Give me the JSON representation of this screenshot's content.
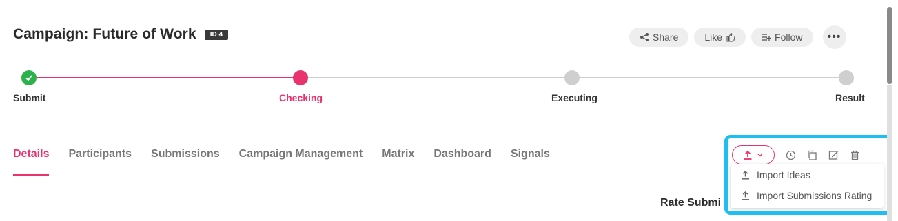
{
  "header": {
    "title": "Campaign: Future of Work",
    "id_badge": "ID 4",
    "share_label": "Share",
    "like_label": "Like",
    "follow_label": "Follow",
    "more_label": "•••"
  },
  "progress": {
    "steps": [
      {
        "label": "Submit",
        "state": "done"
      },
      {
        "label": "Checking",
        "state": "active"
      },
      {
        "label": "Executing",
        "state": "todo"
      },
      {
        "label": "Result",
        "state": "todo"
      }
    ]
  },
  "tabs": [
    {
      "label": "Details",
      "active": true
    },
    {
      "label": "Participants",
      "active": false
    },
    {
      "label": "Submissions",
      "active": false
    },
    {
      "label": "Campaign Management",
      "active": false
    },
    {
      "label": "Matrix",
      "active": false
    },
    {
      "label": "Dashboard",
      "active": false
    },
    {
      "label": "Signals",
      "active": false
    }
  ],
  "toolbar": {
    "icons": [
      "upload-icon",
      "chevron-down-icon",
      "history-icon",
      "copy-icon",
      "edit-icon",
      "trash-icon"
    ]
  },
  "import_menu": {
    "items": [
      "Import Ideas",
      "Import Submissions Rating"
    ]
  },
  "content": {
    "rate_label": "Rate Submi"
  },
  "colors": {
    "accent": "#e8336e",
    "success": "#2bb24c",
    "inactive": "#cfcfcf",
    "highlight": "#1ebff0"
  }
}
